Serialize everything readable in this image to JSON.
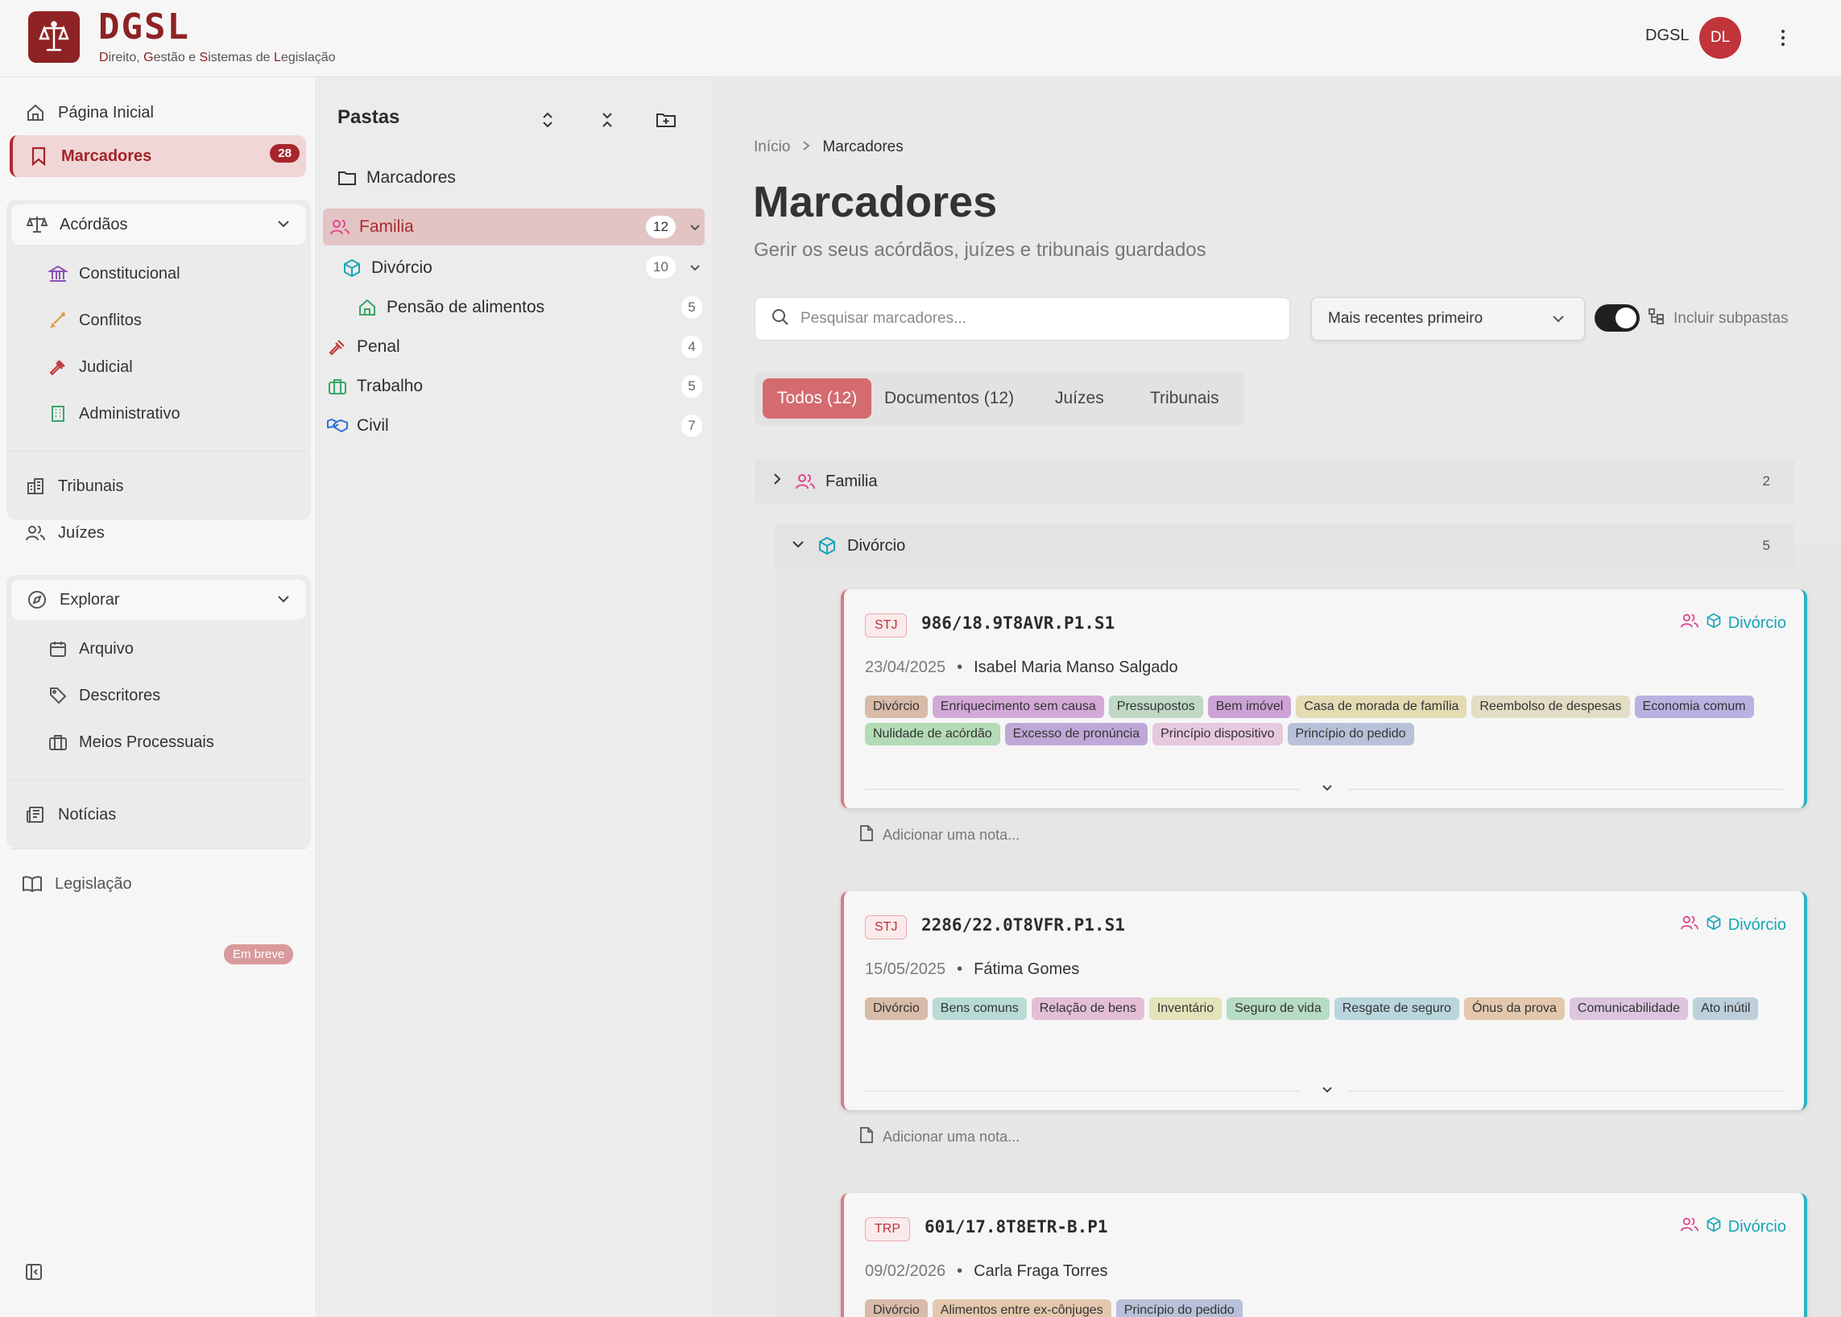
{
  "app": {
    "logo_text": "DGSL",
    "subtitle_parts": [
      "D",
      "ireito, ",
      "G",
      "estão e ",
      "S",
      "istemas de ",
      "L",
      "egislação"
    ],
    "user_name": "DGSL",
    "user_initials": "DL",
    "brand_color": "#8e2224"
  },
  "sidebar": {
    "home": "Página Inicial",
    "bookmarks": {
      "label": "Marcadores",
      "count": "28"
    },
    "acordaos": {
      "label": "Acórdãos",
      "items": [
        "Constitucional",
        "Conflitos",
        "Judicial",
        "Administrativo"
      ]
    },
    "tribunais": "Tribunais",
    "juizes": "Juízes",
    "explorar": {
      "label": "Explorar",
      "items": [
        "Arquivo",
        "Descritores",
        "Meios Processuais"
      ]
    },
    "noticias": "Notícias",
    "legislacao": {
      "label": "Legislação",
      "badge": "Em breve"
    }
  },
  "folders": {
    "title": "Pastas",
    "root": "Marcadores",
    "items": [
      {
        "label": "Familia",
        "count": "12",
        "icon": "family-icon"
      },
      {
        "label": "Divórcio",
        "count": "10",
        "icon": "cube-icon"
      },
      {
        "label": "Pensão de alimentos",
        "count": "5",
        "icon": "house-icon"
      },
      {
        "label": "Penal",
        "count": "4",
        "icon": "gavel-icon"
      },
      {
        "label": "Trabalho",
        "count": "5",
        "icon": "briefcase-icon"
      },
      {
        "label": "Civil",
        "count": "7",
        "icon": "handshake-icon"
      }
    ]
  },
  "main": {
    "breadcrumb": [
      "Início",
      "Marcadores"
    ],
    "title": "Marcadores",
    "subtitle": "Gerir os seus acórdãos, juízes e tribunais guardados",
    "search_placeholder": "Pesquisar marcadores...",
    "sort": "Mais recentes primeiro",
    "include_subfolders": "Incluir subpastas",
    "tabs": [
      "Todos (12)",
      "Documentos (12)",
      "Juízes",
      "Tribunais"
    ],
    "groups": [
      {
        "label": "Familia",
        "count": "2"
      },
      {
        "label": "Divórcio",
        "count": "5"
      }
    ],
    "note_placeholder": "Adicionar uma nota...",
    "cards": [
      {
        "court": "STJ",
        "process": "986/18.9T8AVR.P1.S1",
        "folder": "Divórcio",
        "date": "23/04/2025",
        "judge": "Isabel Maria Manso Salgado",
        "tags": [
          {
            "t": "Divórcio",
            "c": "#d8bba8"
          },
          {
            "t": "Enriquecimento sem causa",
            "c": "#d3a9d8"
          },
          {
            "t": "Pressupostos",
            "c": "#bfd9c6"
          },
          {
            "t": "Bem imóvel",
            "c": "#cda3d6"
          },
          {
            "t": "Casa de morada de família",
            "c": "#e3dbb2"
          },
          {
            "t": "Reembolso de despesas",
            "c": "#e2ddc4"
          },
          {
            "t": "Economia comum",
            "c": "#b7b2e0"
          },
          {
            "t": "Nulidade de acórdão",
            "c": "#b3dbb6"
          },
          {
            "t": "Excesso de pronúncia",
            "c": "#bfa8d8"
          },
          {
            "t": "Princípio dispositivo",
            "c": "#e6c8df"
          },
          {
            "t": "Princípio do pedido",
            "c": "#b9c0d9"
          }
        ]
      },
      {
        "court": "STJ",
        "process": "2286/22.0T8VFR.P1.S1",
        "folder": "Divórcio",
        "date": "15/05/2025",
        "judge": "Fátima Gomes",
        "tags": [
          {
            "t": "Divórcio",
            "c": "#d8bba8"
          },
          {
            "t": "Bens comuns",
            "c": "#b8dbd6"
          },
          {
            "t": "Relação de bens",
            "c": "#e3bfd6"
          },
          {
            "t": "Inventário",
            "c": "#e2e3b8"
          },
          {
            "t": "Seguro de vida",
            "c": "#b7dbc4"
          },
          {
            "t": "Resgate de seguro",
            "c": "#b9d6dd"
          },
          {
            "t": "Ónus da prova",
            "c": "#e3c8ad"
          },
          {
            "t": "Comunicabilidade",
            "c": "#ddc4df"
          },
          {
            "t": "Ato inútil",
            "c": "#bccfdb"
          }
        ]
      },
      {
        "court": "TRP",
        "process": "601/17.8T8ETR-B.P1",
        "folder": "Divórcio",
        "date": "09/02/2026",
        "judge": "Carla Fraga Torres",
        "tags": [
          {
            "t": "Divórcio",
            "c": "#d8bba8"
          },
          {
            "t": "Alimentos entre ex-cônjuges",
            "c": "#e3c8ad"
          },
          {
            "t": "Princípio do pedido",
            "c": "#b9c0d9"
          }
        ]
      }
    ]
  },
  "colors": {
    "accent": "#a8262b",
    "active_tab": "#d46b6f",
    "folder_teal": "#17a5b6",
    "family_pink": "#e0468e"
  }
}
